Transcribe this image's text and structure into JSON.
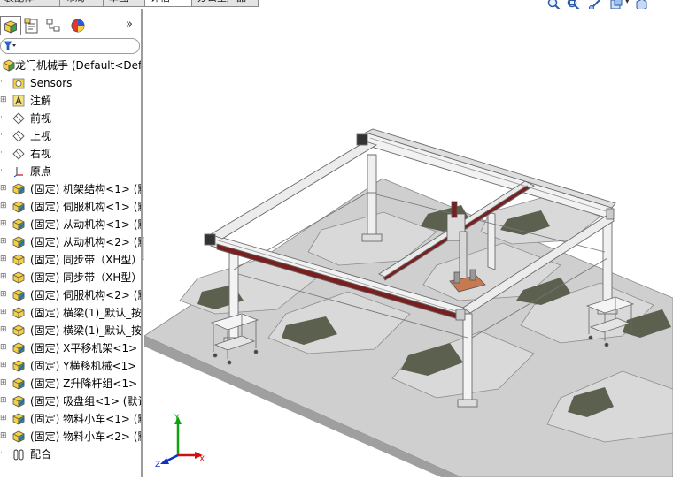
{
  "command_tabs": [
    {
      "label": "装配体",
      "active": false
    },
    {
      "label": "布局",
      "active": false
    },
    {
      "label": "草图",
      "active": false
    },
    {
      "label": "评估",
      "active": true
    },
    {
      "label": "办公室产品",
      "active": false
    }
  ],
  "feature_tree": {
    "root": "龙门机械手  (Default<Def",
    "items": [
      {
        "label": "Sensors",
        "icon": "sensor-icon",
        "expandable": false
      },
      {
        "label": "注解",
        "icon": "annotation-icon",
        "expandable": true
      },
      {
        "label": "前视",
        "icon": "plane-icon",
        "expandable": false
      },
      {
        "label": "上视",
        "icon": "plane-icon",
        "expandable": false
      },
      {
        "label": "右视",
        "icon": "plane-icon",
        "expandable": false
      },
      {
        "label": "原点",
        "icon": "origin-icon",
        "expandable": false
      },
      {
        "label": "(固定) 机架结构<1> (默",
        "icon": "subassembly-icon",
        "expandable": true
      },
      {
        "label": "(固定) 伺服机构<1> (默",
        "icon": "subassembly-icon",
        "expandable": true
      },
      {
        "label": "(固定) 从动机构<1> (默",
        "icon": "subassembly-icon",
        "expandable": true
      },
      {
        "label": "(固定) 从动机构<2> (默",
        "icon": "subassembly-icon",
        "expandable": true
      },
      {
        "label": "(固定) 同步带（XH型）",
        "icon": "part-icon",
        "expandable": true
      },
      {
        "label": "(固定) 同步带（XH型）",
        "icon": "part-icon",
        "expandable": true
      },
      {
        "label": "(固定) 伺服机构<2> (默",
        "icon": "subassembly-icon",
        "expandable": true
      },
      {
        "label": "(固定) 横梁(1)_默认_按",
        "icon": "part-icon",
        "expandable": true
      },
      {
        "label": "(固定) 横梁(1)_默认_按",
        "icon": "part-icon",
        "expandable": true
      },
      {
        "label": "(固定) X平移机架<1> (",
        "icon": "subassembly-icon",
        "expandable": true
      },
      {
        "label": "(固定) Y横移机械<1> (",
        "icon": "subassembly-icon",
        "expandable": true
      },
      {
        "label": "(固定) Z升降杆组<1> (",
        "icon": "subassembly-icon",
        "expandable": true
      },
      {
        "label": "(固定) 吸盘组<1> (默认",
        "icon": "subassembly-icon",
        "expandable": true
      },
      {
        "label": "(固定) 物料小车<1> (默",
        "icon": "subassembly-icon",
        "expandable": true
      },
      {
        "label": "(固定) 物料小车<2> (默",
        "icon": "subassembly-icon",
        "expandable": true
      },
      {
        "label": "配合",
        "icon": "mates-icon",
        "expandable": false
      }
    ]
  },
  "triad": {
    "x": "X",
    "y": "Y",
    "z": "Z"
  },
  "colors": {
    "frame": "#ececec",
    "frame_edge": "#6a6a6a",
    "rail_red": "#7a1f1f",
    "floor_light": "#d6d6d6",
    "floor_dark": "#b9b9b9",
    "floor_pattern": "#5e6353",
    "triad_x": "#d01010",
    "triad_y": "#10a010",
    "triad_z": "#1030c0"
  }
}
